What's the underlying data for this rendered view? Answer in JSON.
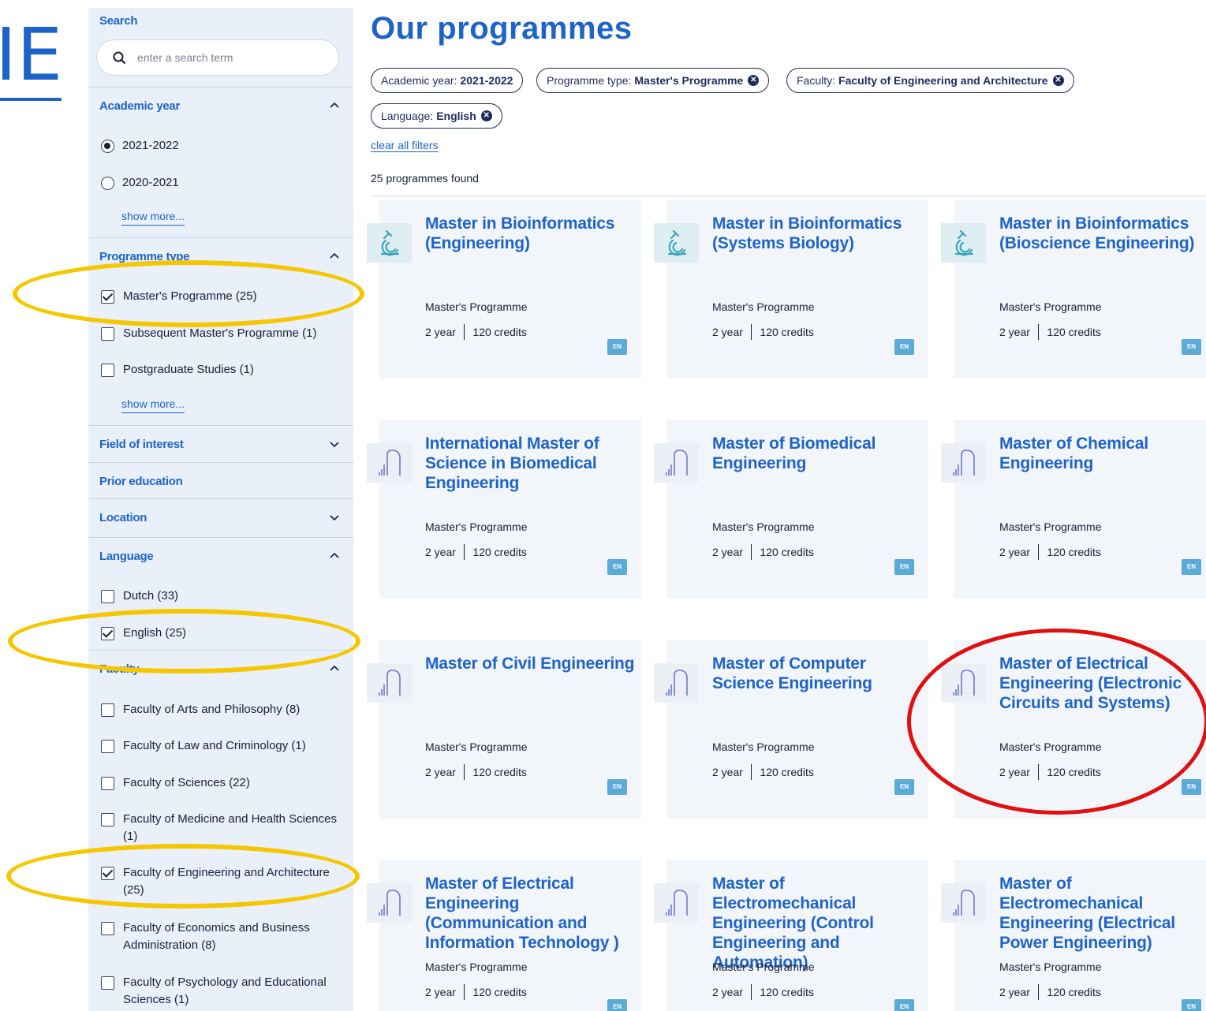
{
  "logo_fragment": "IE",
  "sidebar": {
    "search_label": "Search",
    "search_placeholder": "enter a search term",
    "academic_year": {
      "label": "Academic year",
      "options": [
        {
          "label": "2021-2022",
          "selected": true
        },
        {
          "label": "2020-2021",
          "selected": false
        }
      ],
      "show_more": "show more..."
    },
    "programme_type": {
      "label": "Programme type",
      "options": [
        {
          "label": "Master's Programme (25)",
          "checked": true
        },
        {
          "label": "Subsequent Master's Programme (1)",
          "checked": false
        },
        {
          "label": "Postgraduate Studies (1)",
          "checked": false
        }
      ],
      "show_more": "show more..."
    },
    "field_of_interest": {
      "label": "Field of interest"
    },
    "prior_education": {
      "label": "Prior education"
    },
    "location": {
      "label": "Location"
    },
    "language": {
      "label": "Language",
      "options": [
        {
          "label": "Dutch (33)",
          "checked": false
        },
        {
          "label": "English (25)",
          "checked": true
        }
      ]
    },
    "faculty": {
      "label": "Faculty",
      "options": [
        {
          "label": "Faculty of Arts and Philosophy (8)",
          "checked": false
        },
        {
          "label": "Faculty of Law and Criminology (1)",
          "checked": false
        },
        {
          "label": "Faculty of Sciences (22)",
          "checked": false
        },
        {
          "label": "Faculty of Medicine and Health Sciences (1)",
          "checked": false
        },
        {
          "label": "Faculty of Engineering and Architecture (25)",
          "checked": true
        },
        {
          "label": "Faculty of Economics and Business Administration (8)",
          "checked": false
        },
        {
          "label": "Faculty of Psychology and Educational Sciences (1)",
          "checked": false
        }
      ]
    }
  },
  "main": {
    "title": "Our programmes",
    "filters": [
      {
        "key": "Academic year:",
        "value": "2021-2022",
        "removable": false
      },
      {
        "key": "Programme type:",
        "value": "Master's Programme",
        "removable": true
      },
      {
        "key": "Faculty:",
        "value": "Faculty of Engineering and Architecture",
        "removable": true
      },
      {
        "key": "Language:",
        "value": "English",
        "removable": true
      }
    ],
    "clear_filters": "clear all filters",
    "results_count": "25 programmes found",
    "programmes": [
      {
        "title": "Master in Bioinformatics (Engineering)",
        "type": "Master's Programme",
        "duration": "2 year",
        "credits": "120 credits",
        "lang": "EN",
        "icon": "microscope-icon"
      },
      {
        "title": "Master in Bioinformatics (Systems Biology)",
        "type": "Master's Programme",
        "duration": "2 year",
        "credits": "120 credits",
        "lang": "EN",
        "icon": "microscope-icon"
      },
      {
        "title": "Master in Bioinformatics (Bioscience Engineering)",
        "type": "Master's Programme",
        "duration": "2 year",
        "credits": "120 credits",
        "lang": "EN",
        "icon": "microscope-icon"
      },
      {
        "title": "International Master of Science in Biomedical Engineering",
        "type": "Master's Programme",
        "duration": "2 year",
        "credits": "120 credits",
        "lang": "EN",
        "icon": "building-bars-icon"
      },
      {
        "title": "Master of Biomedical Engineering",
        "type": "Master's Programme",
        "duration": "2 year",
        "credits": "120 credits",
        "lang": "EN",
        "icon": "building-bars-icon"
      },
      {
        "title": "Master of Chemical Engineering",
        "type": "Master's Programme",
        "duration": "2 year",
        "credits": "120 credits",
        "lang": "EN",
        "icon": "building-bars-icon"
      },
      {
        "title": "Master of Civil Engineering",
        "type": "Master's Programme",
        "duration": "2 year",
        "credits": "120 credits",
        "lang": "EN",
        "icon": "building-bars-icon"
      },
      {
        "title": "Master of Computer Science Engineering",
        "type": "Master's Programme",
        "duration": "2 year",
        "credits": "120 credits",
        "lang": "EN",
        "icon": "building-bars-icon"
      },
      {
        "title": "Master of Electrical Engineering (Electronic Circuits and Systems)",
        "type": "Master's Programme",
        "duration": "2 year",
        "credits": "120 credits",
        "lang": "EN",
        "icon": "building-bars-icon"
      },
      {
        "title": "Master of Electrical Engineering (Communication and Information Technology )",
        "type": "Master's Programme",
        "duration": "2 year",
        "credits": "120 credits",
        "lang": "EN",
        "icon": "building-bars-icon"
      },
      {
        "title": "Master of Electromechanical Engineering (Control Engineering and Automation)",
        "type": "Master's Programme",
        "duration": "2 year",
        "credits": "120 credits",
        "lang": "EN",
        "icon": "building-bars-icon"
      },
      {
        "title": "Master of Electromechanical Engineering (Electrical Power Engineering)",
        "type": "Master's Programme",
        "duration": "2 year",
        "credits": "120 credits",
        "lang": "EN",
        "icon": "building-bars-icon"
      }
    ]
  },
  "colors": {
    "accent": "#1e64c8",
    "highlight_yellow": "#f5c700",
    "highlight_red": "#e01010",
    "lang_badge": "#5aabd8"
  }
}
